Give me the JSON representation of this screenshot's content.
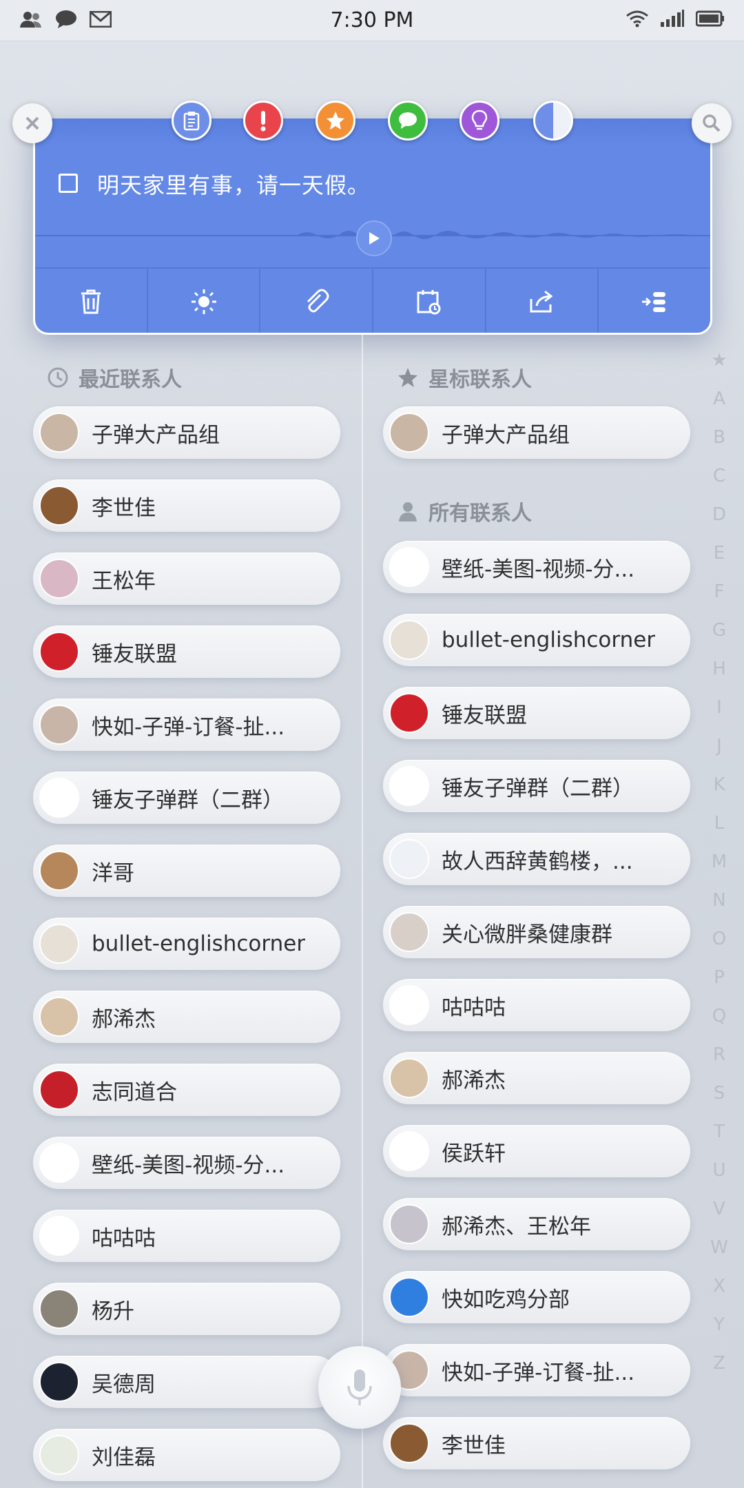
{
  "status_bar": {
    "time": "7:30 PM",
    "left_icons": [
      "contacts-icon",
      "chat-bubble-icon",
      "mail-icon"
    ],
    "right_icons": [
      "wifi-icon",
      "signal-icon",
      "battery-icon"
    ]
  },
  "note": {
    "text": "明天家里有事，请一天假。",
    "checked": false,
    "tags": [
      {
        "icon": "clipboard-icon",
        "color": "#6e8ee8"
      },
      {
        "icon": "exclamation-icon",
        "color": "#e9434b"
      },
      {
        "icon": "star-icon",
        "color": "#f39036"
      },
      {
        "icon": "message-icon",
        "color": "#3fbd3f"
      },
      {
        "icon": "lightbulb-icon",
        "color": "#9d57d8"
      },
      {
        "icon": "half-circle-icon",
        "color": "#6e8ee8"
      }
    ],
    "actions": [
      "trash-icon",
      "brightness-icon",
      "paperclip-icon",
      "calendar-reminder-icon",
      "share-icon",
      "send-to-icon"
    ]
  },
  "sections": {
    "recent": "最近联系人",
    "starred": "星标联系人",
    "all": "所有联系人"
  },
  "recent_contacts": [
    {
      "name": "子弹大产品组",
      "avatar_color": "#c9b6a4"
    },
    {
      "name": "李世佳",
      "avatar_color": "#8a5a33"
    },
    {
      "name": "王松年",
      "avatar_color": "#d9b7c4"
    },
    {
      "name": "锤友联盟",
      "avatar_color": "#d0202a"
    },
    {
      "name": "快如-子弹-订餐-扯...",
      "avatar_color": "#c8b5a8"
    },
    {
      "name": "锤友子弹群（二群）",
      "avatar_color": "#ffffff"
    },
    {
      "name": "洋哥",
      "avatar_color": "#b5875a"
    },
    {
      "name": "bullet-englishcorner",
      "avatar_color": "#e6e0d6"
    },
    {
      "name": "郝浠杰",
      "avatar_color": "#d8c2a8"
    },
    {
      "name": "志同道合",
      "avatar_color": "#c5202a"
    },
    {
      "name": "壁纸-美图-视频-分...",
      "avatar_color": "#ffffff"
    },
    {
      "name": "咕咕咕",
      "avatar_color": "#ffffff"
    },
    {
      "name": "杨升",
      "avatar_color": "#8a8378"
    },
    {
      "name": "吴德周",
      "avatar_color": "#1d2230"
    },
    {
      "name": "刘佳磊",
      "avatar_color": "#e6ece2"
    }
  ],
  "starred_contacts": [
    {
      "name": "子弹大产品组",
      "avatar_color": "#c9b6a4"
    }
  ],
  "all_contacts": [
    {
      "name": "壁纸-美图-视频-分...",
      "avatar_color": "#ffffff"
    },
    {
      "name": "bullet-englishcorner",
      "avatar_color": "#e6e0d6"
    },
    {
      "name": "锤友联盟",
      "avatar_color": "#d0202a"
    },
    {
      "name": "锤友子弹群（二群）",
      "avatar_color": "#ffffff"
    },
    {
      "name": "故人西辞黄鹤楼，...",
      "avatar_color": "#eef1f6"
    },
    {
      "name": "关心微胖桑健康群",
      "avatar_color": "#d8cfc8"
    },
    {
      "name": "咕咕咕",
      "avatar_color": "#ffffff"
    },
    {
      "name": "郝浠杰",
      "avatar_color": "#d8c2a8"
    },
    {
      "name": "侯跃轩",
      "avatar_color": "#ffffff"
    },
    {
      "name": "郝浠杰、王松年",
      "avatar_color": "#c7c3cc"
    },
    {
      "name": "快如吃鸡分部",
      "avatar_color": "#2f7fe0"
    },
    {
      "name": "快如-子弹-订餐-扯...",
      "avatar_color": "#c8b5a8"
    },
    {
      "name": "李世佳",
      "avatar_color": "#8a5a33"
    }
  ],
  "alphabet": [
    "★",
    "A",
    "B",
    "C",
    "D",
    "E",
    "F",
    "G",
    "H",
    "I",
    "J",
    "K",
    "L",
    "M",
    "N",
    "O",
    "P",
    "Q",
    "R",
    "S",
    "T",
    "U",
    "V",
    "W",
    "X",
    "Y",
    "Z"
  ],
  "mic": {
    "icon": "microphone-icon"
  }
}
